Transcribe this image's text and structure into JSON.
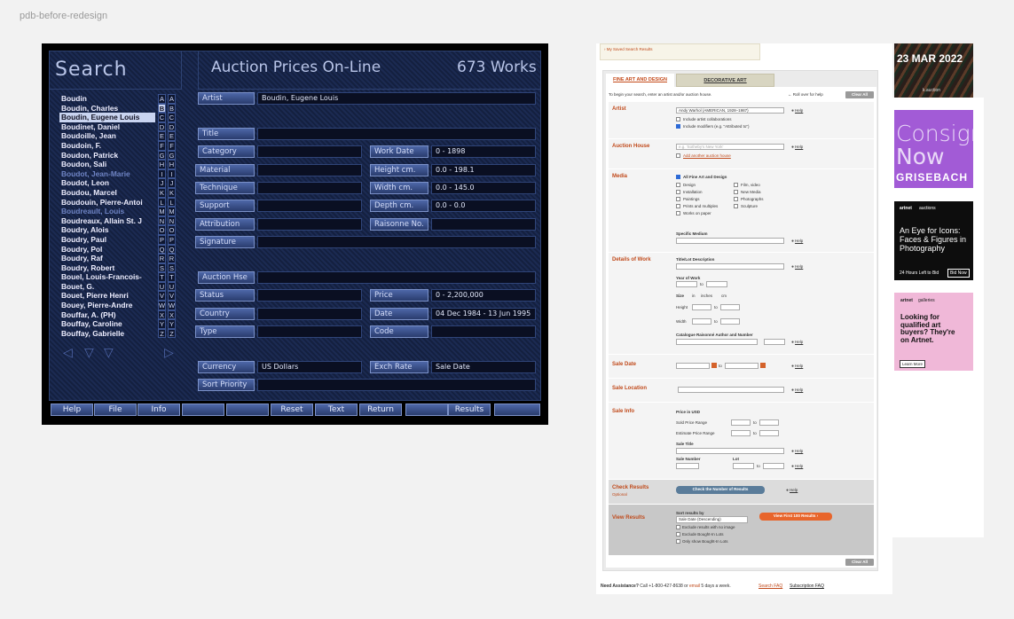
{
  "page_label": "pdb-before-redesign",
  "retro": {
    "search_title": "Search",
    "title": "Auction Prices On-Line",
    "works_count": "673 Works",
    "names": [
      {
        "n": "Boudin",
        "s": "norm"
      },
      {
        "n": "Boudin, Charles",
        "s": "norm"
      },
      {
        "n": "Boudin, Eugene Louis",
        "s": "sel"
      },
      {
        "n": "Boudinet, Daniel",
        "s": "norm"
      },
      {
        "n": "Boudoille, Jean",
        "s": "norm"
      },
      {
        "n": "Boudoin, F.",
        "s": "norm"
      },
      {
        "n": "Boudon, Patrick",
        "s": "norm"
      },
      {
        "n": "Boudon, Sali",
        "s": "norm"
      },
      {
        "n": "Boudot, Jean-Marie",
        "s": "dim"
      },
      {
        "n": "Boudot, Leon",
        "s": "norm"
      },
      {
        "n": "Boudou, Marcel",
        "s": "norm"
      },
      {
        "n": "Boudouin, Pierre-Antoi",
        "s": "norm"
      },
      {
        "n": "Boudreault, Louis",
        "s": "dim"
      },
      {
        "n": "Boudreaux, Allain St. J",
        "s": "norm"
      },
      {
        "n": "Boudry, Alois",
        "s": "norm"
      },
      {
        "n": "Boudry, Paul",
        "s": "norm"
      },
      {
        "n": "Boudry, Pol",
        "s": "norm"
      },
      {
        "n": "Boudry, Raf",
        "s": "norm"
      },
      {
        "n": "Boudry, Robert",
        "s": "norm"
      },
      {
        "n": "Bouel, Louis-Francois-",
        "s": "norm"
      },
      {
        "n": "Bouet, G.",
        "s": "norm"
      },
      {
        "n": "Bouet, Pierre Henri",
        "s": "norm"
      },
      {
        "n": "Bouey, Pierre-Andre",
        "s": "norm"
      },
      {
        "n": "Bouffar, A. (PH)",
        "s": "norm"
      },
      {
        "n": "Bouffay, Caroline",
        "s": "norm"
      },
      {
        "n": "Bouffay, Gabrielle",
        "s": "norm"
      }
    ],
    "letters": [
      [
        "A",
        "A"
      ],
      [
        "B",
        "B"
      ],
      [
        "C",
        "C"
      ],
      [
        "D",
        "D"
      ],
      [
        "E",
        "E"
      ],
      [
        "F",
        "F"
      ],
      [
        "G",
        "G"
      ],
      [
        "H",
        "H"
      ],
      [
        "I",
        "I"
      ],
      [
        "J",
        "J"
      ],
      [
        "K",
        "K"
      ],
      [
        "L",
        "L"
      ],
      [
        "M",
        "M"
      ],
      [
        "N",
        "N"
      ],
      [
        "O",
        "O"
      ],
      [
        "P",
        "P"
      ],
      [
        "Q",
        "Q"
      ],
      [
        "R",
        "R"
      ],
      [
        "S",
        "S"
      ],
      [
        "T",
        "T"
      ],
      [
        "U",
        "U"
      ],
      [
        "V",
        "V"
      ],
      [
        "W",
        "W"
      ],
      [
        "X",
        "X"
      ],
      [
        "Y",
        "Y"
      ],
      [
        "Z",
        "Z"
      ]
    ],
    "active_letter_index": 1,
    "fields": {
      "artist_label": "Artist",
      "artist_value": "Boudin, Eugene Louis",
      "title_label": "Title",
      "category_label": "Category",
      "material_label": "Material",
      "technique_label": "Technique",
      "support_label": "Support",
      "attribution_label": "Attribution",
      "signature_label": "Signature",
      "workdate_label": "Work Date",
      "workdate_value": "0 - 1898",
      "height_label": "Height cm.",
      "height_value": "0.0 - 198.1",
      "width_label": "Width cm.",
      "width_value": "0.0 - 145.0",
      "depth_label": "Depth cm.",
      "depth_value": "0.0 - 0.0",
      "raisonne_label": "Raisonne No.",
      "auction_label": "Auction Hse",
      "status_label": "Status",
      "country_label": "Country",
      "type_label": "Type",
      "price_label": "Price",
      "price_value": "0 - 2,200,000",
      "date_label": "Date",
      "date_value": "04 Dec 1984 - 13 Jun 1995",
      "code_label": "Code",
      "currency_label": "Currency",
      "currency_value": "US Dollars",
      "exch_label": "Exch Rate",
      "exch_value": "Sale Date",
      "sort_label": "Sort Priority"
    },
    "bottom_buttons": [
      "Help",
      "File",
      "Info",
      "",
      "",
      "Reset",
      "Text",
      "Return",
      "",
      "Results",
      ""
    ]
  },
  "web": {
    "saved_link": "› My Saved Search Results",
    "tab_fine": "FINE ART AND DESIGN",
    "tab_decorative": "DECORATIVE ART",
    "intro": "To begin your search, enter an artist and/or auction house.",
    "rollover": "← Roll over for help",
    "clear_all": "Clear All",
    "help": "Help",
    "artist": {
      "label": "Artist",
      "value": "Andy Warhol (AMERICAN, 1928–1987)",
      "opt1": "Include artist collaborations",
      "opt2": "Include modifiers (e.g. \"Attributed to\")"
    },
    "auction_house": {
      "label": "Auction House",
      "placeholder": "e.g. 'Sotheby's New York'",
      "add": "Add another auction house"
    },
    "media": {
      "label": "Media",
      "all": "All Fine Art and Design",
      "left": [
        "Design",
        "Installation",
        "Paintings",
        "Prints and multiples",
        "Works on paper"
      ],
      "right": [
        "Film, video",
        "New Media",
        "Photographs",
        "Sculpture"
      ],
      "specific": "Specific Medium"
    },
    "details": {
      "label": "Details of Work",
      "title_desc": "Title/Lot Description",
      "year": "Year of Work",
      "to": "to",
      "size": "Size",
      "in": "in",
      "inches": "inches",
      "cm": "cm",
      "height": "Height",
      "width": "Width",
      "catalogue": "Catalogue Raisonné Author and Number"
    },
    "sale_date": {
      "label": "Sale Date",
      "to": "to"
    },
    "sale_location": {
      "label": "Sale Location"
    },
    "sale_info": {
      "label": "Sale Info",
      "price_usd": "Price in USD",
      "sold": "Sold Price Range",
      "estimate": "Estimate Price Range",
      "to": "to",
      "sale_title": "Sale Title",
      "sale_number": "Sale Number",
      "lot": "Lot"
    },
    "check": {
      "label": "Check Results",
      "optional": "Optional",
      "button": "Check the Number of Results"
    },
    "view": {
      "label": "View Results",
      "sort_by": "Sort results by",
      "sort_value": "Sale Date (Descending)",
      "button": "View First 100 Results ›",
      "opt1": "Exclude results with no image",
      "opt2": "Exclude Bought-In Lots",
      "opt3": "Only show Bought-In Lots"
    },
    "footer": {
      "need": "Need Assistance?",
      "text": " Call +1-800-427-8638 or ",
      "email": "email",
      "days": " 5 days a week.",
      "faq": "Search FAQ",
      "sub": "Subscription FAQ"
    }
  },
  "ads": {
    "ad1": {
      "date": "23 MAR 2022",
      "brand": "k.auction"
    },
    "ad2": {
      "line1": "Consign",
      "line2": "Now",
      "brand": "GRISEBACH"
    },
    "ad3": {
      "top1": "artnet",
      "top2": "auctions",
      "headline": "An Eye for Icons: Faces & Figures in Photography",
      "left": "24 Hours Left to Bid",
      "btn": "Bid Now"
    },
    "ad4": {
      "top1": "artnet",
      "top2": "galleries",
      "headline": "Looking for qualified art buyers? They're on Artnet.",
      "btn": "Learn More"
    }
  },
  "colors": {
    "artnet_red": "#c04a1b",
    "retro_blue": "#1b2a52",
    "grisebach_purple": "#a25bd6",
    "pink": "#f0b8d8"
  }
}
